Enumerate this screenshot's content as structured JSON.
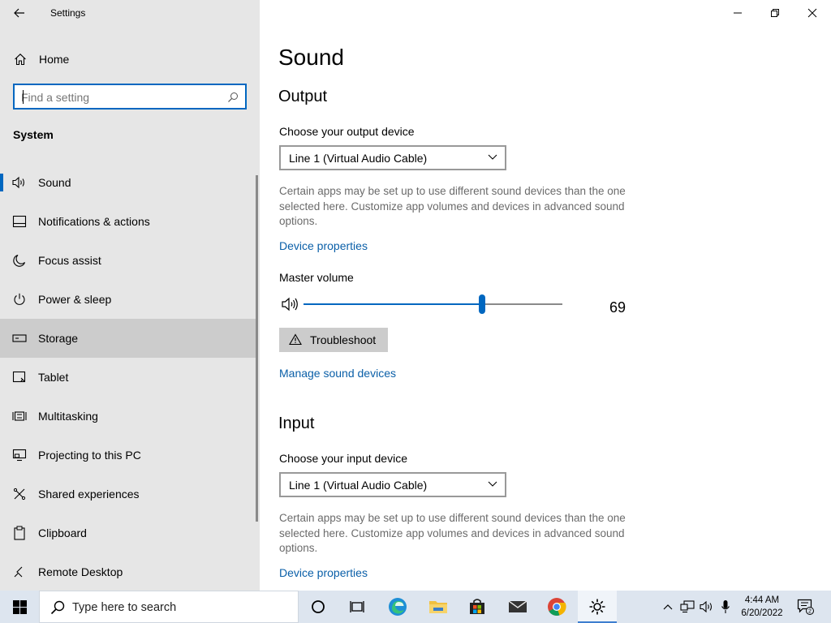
{
  "app": {
    "title": "Settings"
  },
  "sidebar": {
    "home_label": "Home",
    "search_placeholder": "Find a setting",
    "section_label": "System",
    "items": [
      {
        "label": "Sound",
        "icon": "speaker-icon"
      },
      {
        "label": "Notifications & actions",
        "icon": "notification-icon"
      },
      {
        "label": "Focus assist",
        "icon": "moon-icon"
      },
      {
        "label": "Power & sleep",
        "icon": "power-icon"
      },
      {
        "label": "Storage",
        "icon": "storage-icon"
      },
      {
        "label": "Tablet",
        "icon": "tablet-icon"
      },
      {
        "label": "Multitasking",
        "icon": "multitasking-icon"
      },
      {
        "label": "Projecting to this PC",
        "icon": "projecting-icon"
      },
      {
        "label": "Shared experiences",
        "icon": "shared-experiences-icon"
      },
      {
        "label": "Clipboard",
        "icon": "clipboard-icon"
      },
      {
        "label": "Remote Desktop",
        "icon": "remote-desktop-icon"
      }
    ],
    "selected_item": "Sound",
    "hovered_item": "Storage"
  },
  "main": {
    "page_title": "Sound",
    "output": {
      "heading": "Output",
      "device_label": "Choose your output device",
      "device_value": "Line 1 (Virtual Audio Cable)",
      "description": "Certain apps may be set up to use different sound devices than the one selected here. Customize app volumes and devices in advanced sound options.",
      "device_properties_link": "Device properties",
      "master_volume_label": "Master volume",
      "master_volume_value": 69,
      "master_volume_display": "69",
      "troubleshoot_label": "Troubleshoot",
      "manage_devices_link": "Manage sound devices"
    },
    "input": {
      "heading": "Input",
      "device_label": "Choose your input device",
      "device_value": "Line 1 (Virtual Audio Cable)",
      "description": "Certain apps may be set up to use different sound devices than the one selected here. Customize app volumes and devices in advanced sound options.",
      "device_properties_link": "Device properties"
    }
  },
  "taskbar": {
    "search_placeholder": "Type here to search",
    "apps": [
      "task-view-icon",
      "edge-icon",
      "file-explorer-icon",
      "store-icon",
      "mail-icon",
      "chrome-icon",
      "settings-icon"
    ],
    "clock_time": "4:44 AM",
    "clock_date": "6/20/2022",
    "notification_count": "2"
  },
  "colors": {
    "accent": "#0067c0",
    "link": "#0a5fa8",
    "sidebar_bg": "#e6e6e6",
    "taskbar_bg": "#dde5ef"
  }
}
